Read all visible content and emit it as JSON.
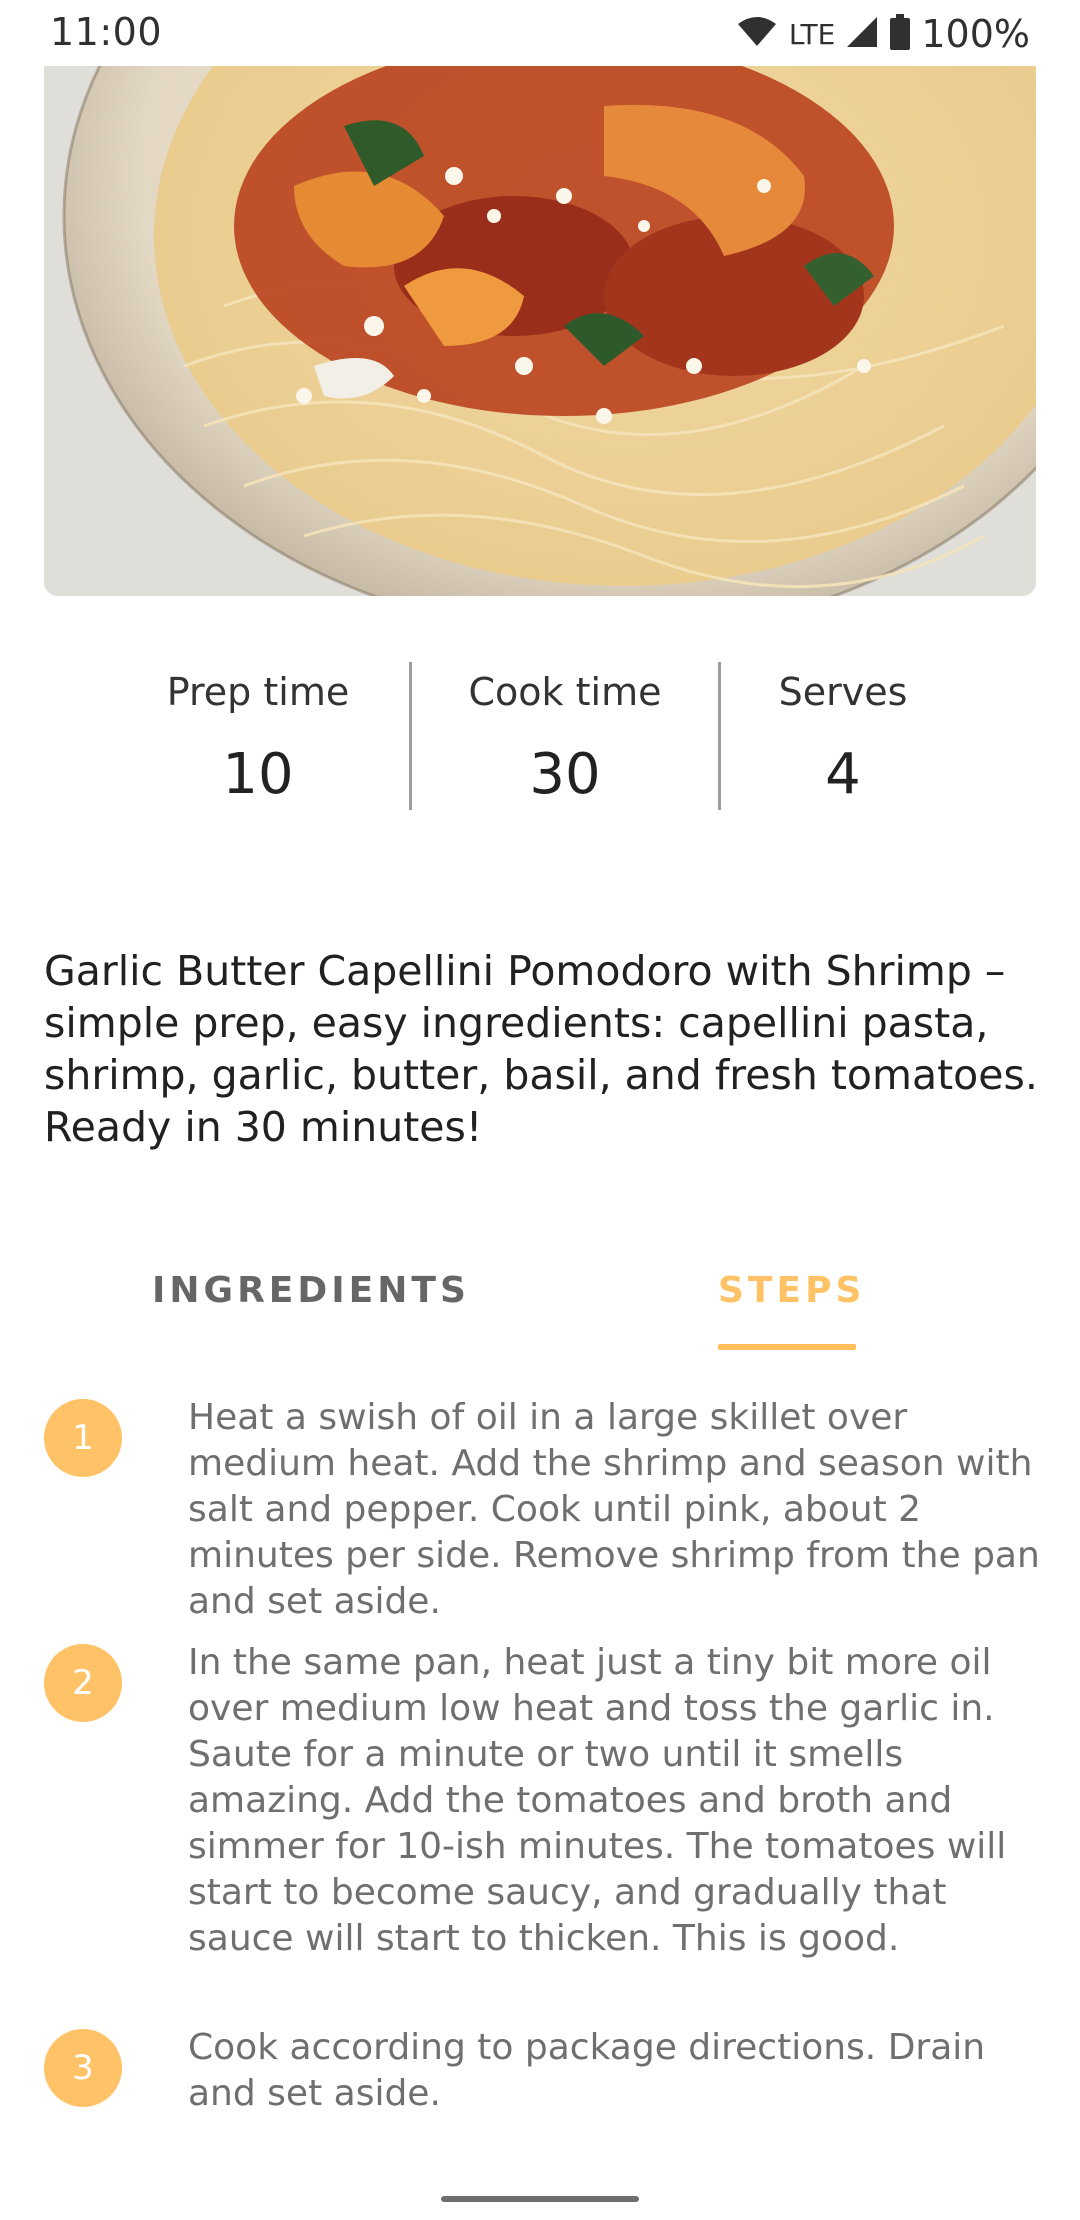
{
  "status_bar": {
    "time": "11:00",
    "network": "LTE",
    "battery": "100%",
    "icons": [
      "wifi-icon",
      "signal-icon",
      "battery-icon"
    ]
  },
  "hero": {
    "image": "shrimp-capellini-pasta-photo"
  },
  "stats": [
    {
      "label": "Prep time",
      "value": "10"
    },
    {
      "label": "Cook time",
      "value": "30"
    },
    {
      "label": "Serves",
      "value": "4"
    }
  ],
  "description": "Garlic Butter Capellini Pomodoro with Shrimp – simple prep, easy ingredients: capellini pasta, shrimp, garlic, butter, basil, and fresh tomatoes. Ready in 30 minutes!",
  "tabs": {
    "ingredients": "INGREDIENTS",
    "steps": "STEPS",
    "active": "steps"
  },
  "steps": [
    {
      "number": "1",
      "text": "Heat a swish of oil in a large skillet over medium heat. Add the shrimp and season with salt and pepper. Cook until pink, about 2 minutes per side. Remove shrimp from the pan and set aside."
    },
    {
      "number": "2",
      "text": "In the same pan, heat just a tiny bit more oil over medium low heat and toss the garlic in. Saute for a minute or two until it smells amazing. Add the tomatoes and broth and simmer for 10-ish minutes. The tomatoes will start to become saucy, and gradually that sauce will start to thicken. This is good."
    },
    {
      "number": "3",
      "text": "Cook according to package directions. Drain and set aside."
    }
  ],
  "colors": {
    "accent": "#ffc266",
    "tab_inactive": "#666666",
    "step_text": "#6f6f6f"
  }
}
